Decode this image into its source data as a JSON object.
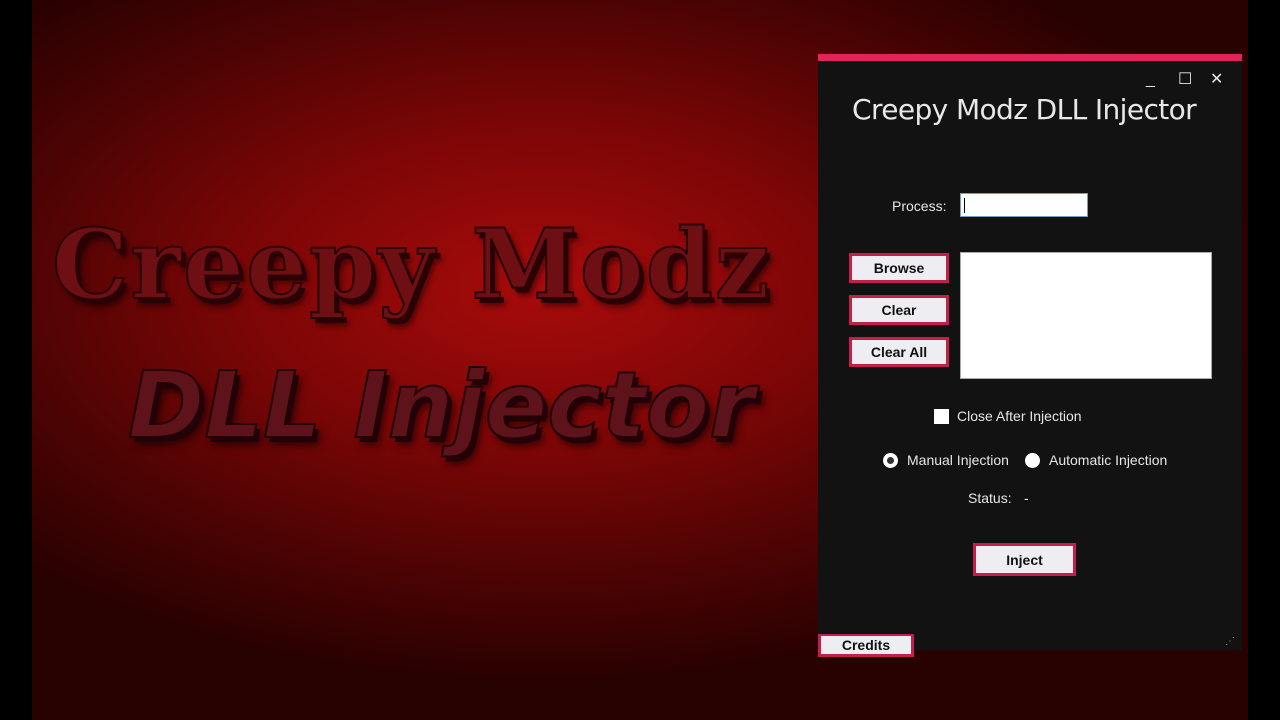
{
  "background": {
    "headline": "Creepy Modz",
    "subheadline": "DLL Injector"
  },
  "window": {
    "title": "Creepy Modz DLL Injector",
    "controls": {
      "minimize": "_",
      "maximize": "☐",
      "close": "✕"
    },
    "process": {
      "label": "Process:",
      "value": ""
    },
    "buttons": {
      "browse": "Browse",
      "clear": "Clear",
      "clear_all": "Clear All",
      "inject": "Inject",
      "credits": "Credits"
    },
    "dll_list": [],
    "close_after_injection": {
      "label": "Close After Injection",
      "checked": false
    },
    "injection_mode": {
      "options": [
        "Manual Injection",
        "Automatic Injection"
      ],
      "selected": "Manual Injection"
    },
    "status": {
      "label": "Status:",
      "value": "-"
    },
    "resize_grip": "⋰"
  },
  "colors": {
    "accent": "#e0245a",
    "button_border": "#c41e4a",
    "window_bg": "#121212"
  }
}
